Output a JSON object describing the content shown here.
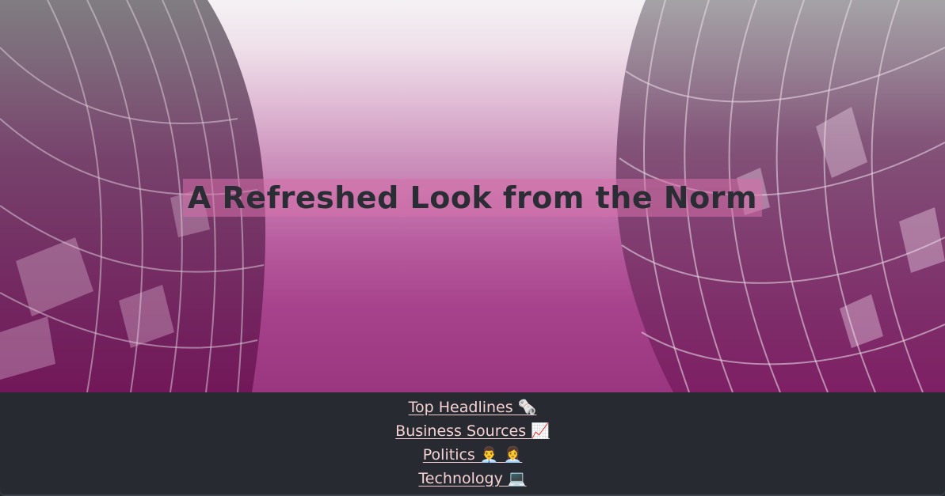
{
  "hero": {
    "title": "A Refreshed Look from the Norm",
    "title_highlight_color": "#d670aa",
    "background_colors": [
      "#f2eff2",
      "#c887b6",
      "#9a357f"
    ],
    "image": "twisting-skyscraper-towers"
  },
  "nav": {
    "items": [
      {
        "label": "Top Headlines 🗞️"
      },
      {
        "label": "Business Sources 📈"
      },
      {
        "label": "Politics 👨‍💼 👩‍💼"
      },
      {
        "label": "Technology 💻"
      }
    ],
    "link_color": "#f6d2d2",
    "background_color": "#272b31"
  }
}
